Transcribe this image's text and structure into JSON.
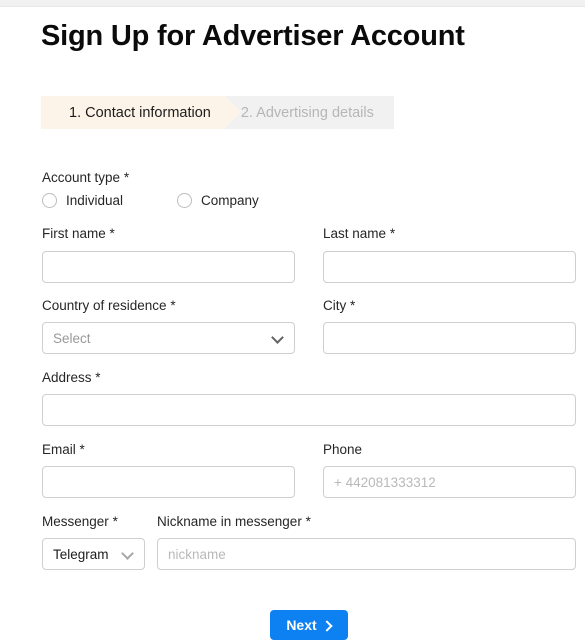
{
  "page": {
    "title": "Sign Up for Advertiser Account"
  },
  "steps": [
    {
      "label": "1. Contact information",
      "state": "active"
    },
    {
      "label": "2. Advertising details",
      "state": "inactive"
    }
  ],
  "form": {
    "account_type": {
      "label": "Account type",
      "required_mark": "*",
      "options": [
        {
          "label": "Individual",
          "selected": false
        },
        {
          "label": "Company",
          "selected": false
        }
      ]
    },
    "first_name": {
      "label": "First name",
      "required_mark": "*",
      "value": "",
      "placeholder": ""
    },
    "last_name": {
      "label": "Last name",
      "required_mark": "*",
      "value": "",
      "placeholder": ""
    },
    "country": {
      "label": "Country of residence",
      "required_mark": "*",
      "selected": "Select",
      "is_placeholder": true
    },
    "city": {
      "label": "City",
      "required_mark": "*",
      "value": "",
      "placeholder": ""
    },
    "address": {
      "label": "Address",
      "required_mark": "*",
      "value": "",
      "placeholder": ""
    },
    "email": {
      "label": "Email",
      "required_mark": "*",
      "value": "",
      "placeholder": ""
    },
    "phone": {
      "label": "Phone",
      "required_mark": "",
      "value": "",
      "placeholder": "+ 442081333312"
    },
    "messenger": {
      "label": "Messenger",
      "required_mark": "*",
      "selected": "Telegram",
      "is_placeholder": false
    },
    "nickname": {
      "label": "Nickname in messenger",
      "required_mark": "*",
      "value": "",
      "placeholder": "nickname"
    }
  },
  "actions": {
    "next_label": "Next"
  },
  "colors": {
    "primary": "#0d80f2",
    "step_active_bg": "#fdf4e9",
    "step_inactive_bg": "#f1f1f1",
    "border": "#cfcfcf"
  }
}
